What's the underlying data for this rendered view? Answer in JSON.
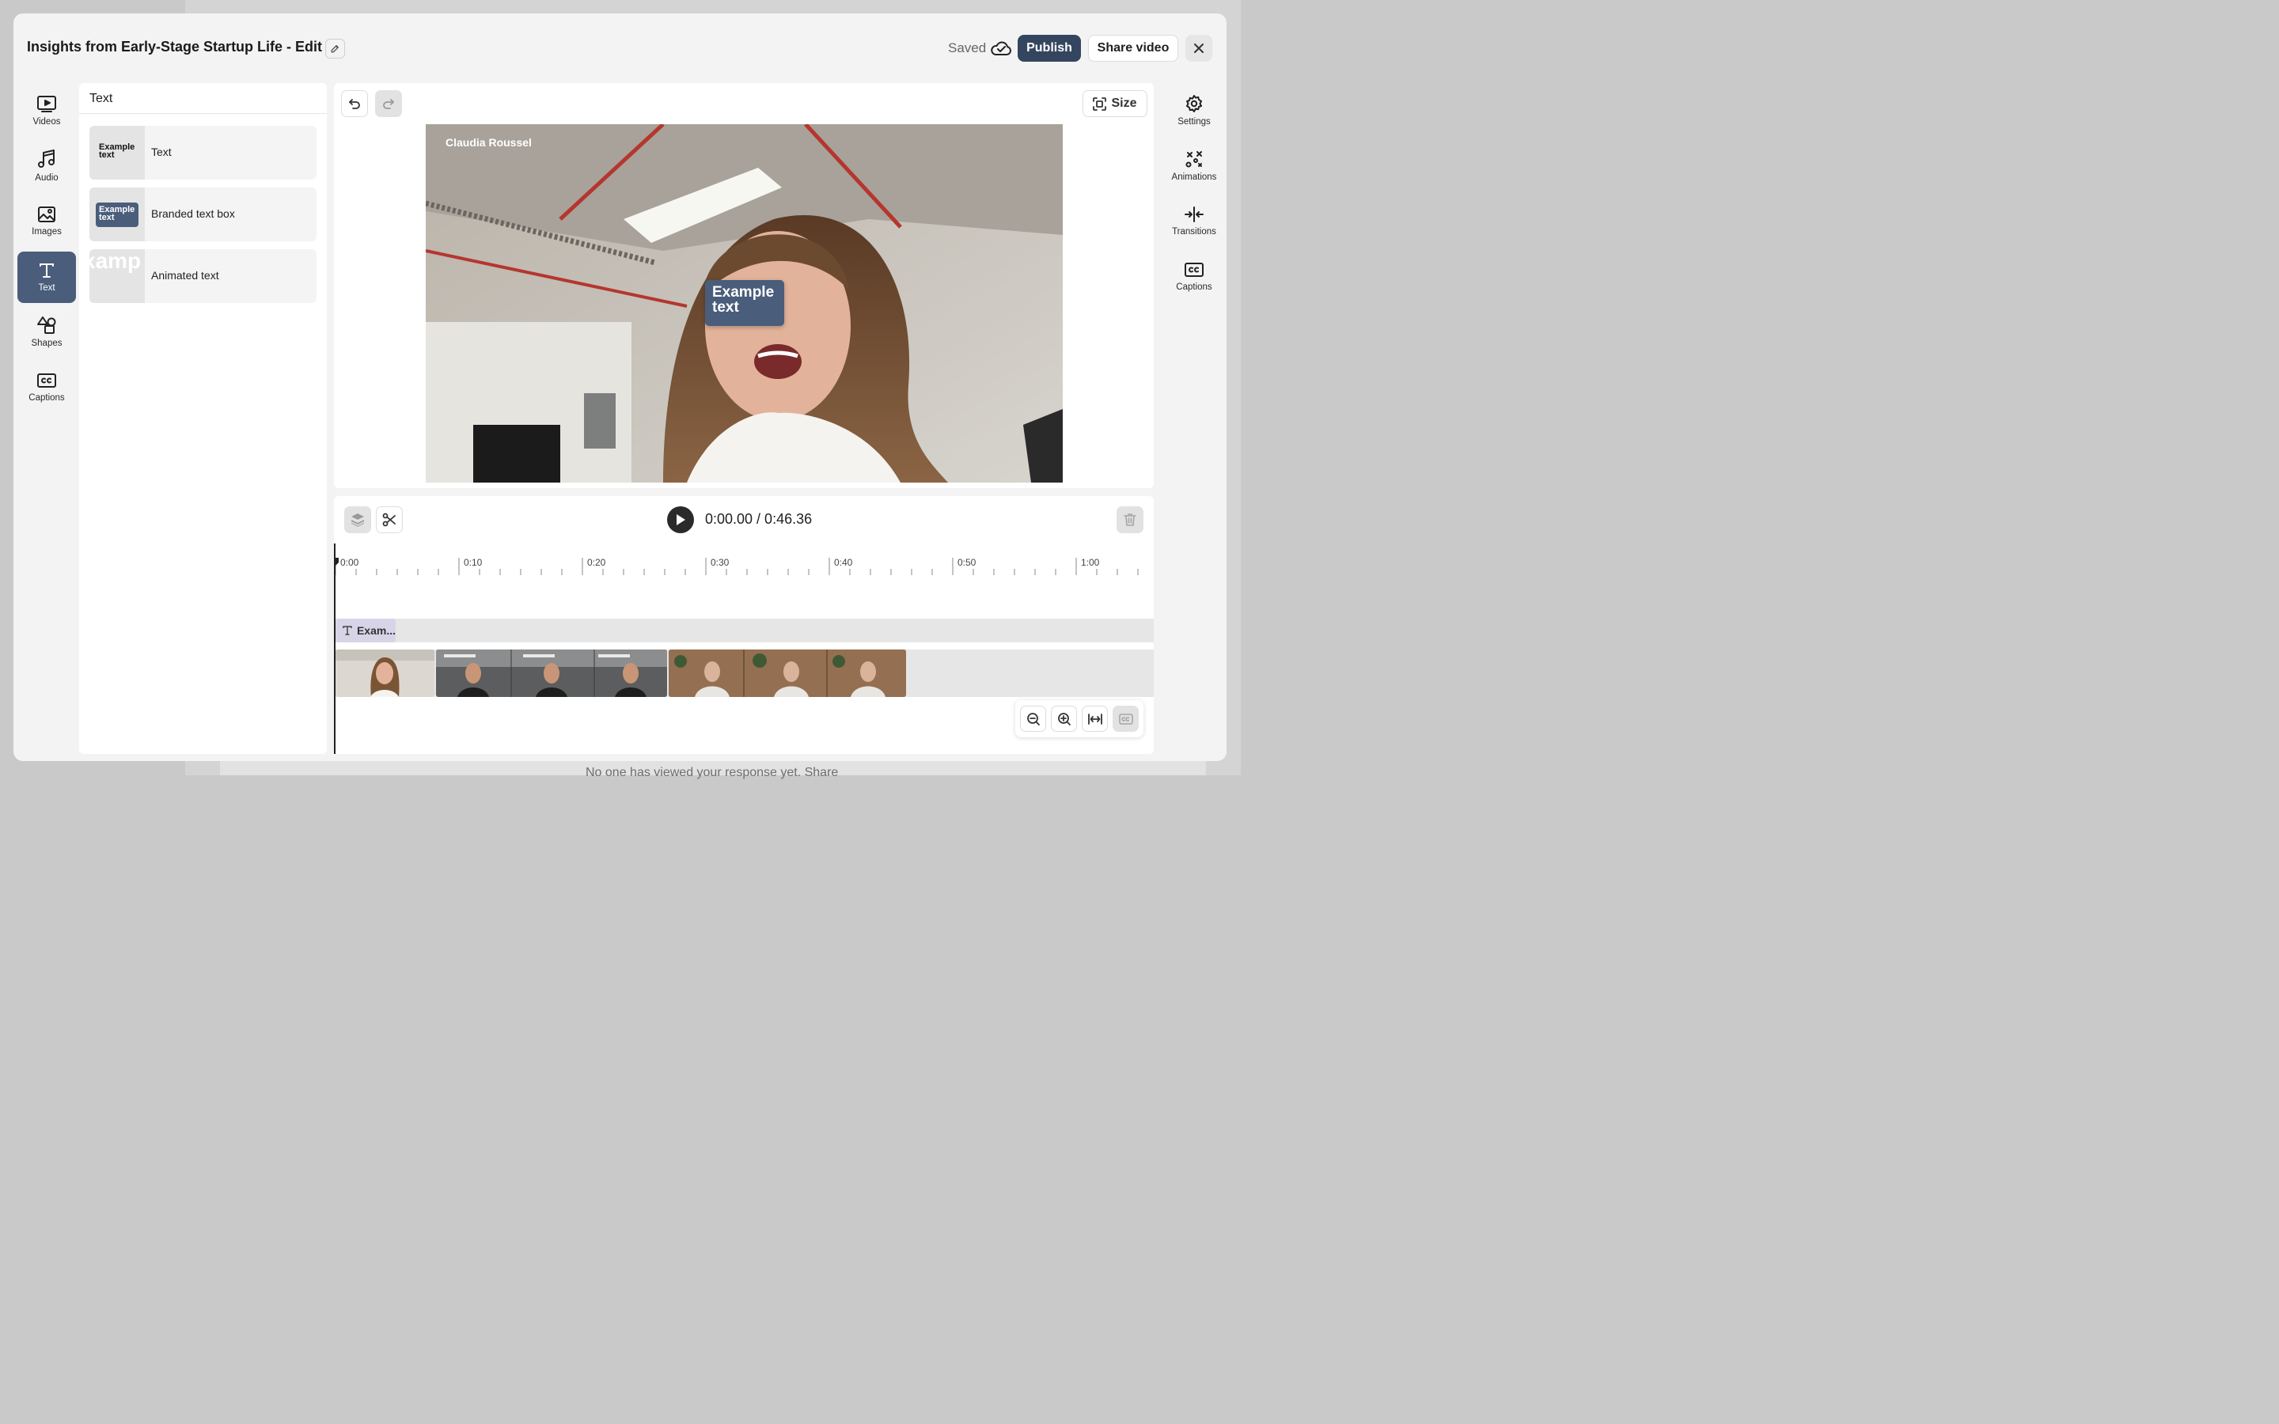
{
  "background": {
    "text": "No one has viewed your response yet. Share"
  },
  "header": {
    "title": "Insights from Early-Stage Startup Life - Edit",
    "status": "Saved",
    "publish_label": "Publish",
    "share_label": "Share video"
  },
  "left_tools": [
    {
      "label": "Videos",
      "icon": "video-icon"
    },
    {
      "label": "Audio",
      "icon": "music-note-icon"
    },
    {
      "label": "Images",
      "icon": "image-icon"
    },
    {
      "label": "Text",
      "icon": "text-icon",
      "active": true
    },
    {
      "label": "Shapes",
      "icon": "shapes-icon"
    },
    {
      "label": "Captions",
      "icon": "cc-icon"
    }
  ],
  "text_panel": {
    "heading": "Text",
    "options": [
      {
        "label": "Text",
        "thumb": "Example text"
      },
      {
        "label": "Branded text box",
        "thumb": "Example text"
      },
      {
        "label": "Animated text",
        "thumb": "xamp text"
      }
    ]
  },
  "right_tools": [
    {
      "label": "Settings",
      "icon": "gear-icon"
    },
    {
      "label": "Animations",
      "icon": "animations-icon"
    },
    {
      "label": "Transitions",
      "icon": "transitions-icon"
    },
    {
      "label": "Captions",
      "icon": "cc-icon"
    }
  ],
  "canvas": {
    "size_label": "Size",
    "speaker_name": "Claudia Roussel",
    "overlay_text": "Example text"
  },
  "timeline": {
    "current_time": "0:00.00",
    "duration": "0:46.36",
    "time_display": "0:00.00 / 0:46.36",
    "ruler_labels": [
      "0:00",
      "0:10",
      "0:20",
      "0:30",
      "0:40",
      "0:50",
      "1:00"
    ],
    "text_clip_label": "Exam..."
  },
  "colors": {
    "accent": "#34465f",
    "active_tool": "#4a5d7b",
    "text_clip": "#d8d4e8"
  }
}
